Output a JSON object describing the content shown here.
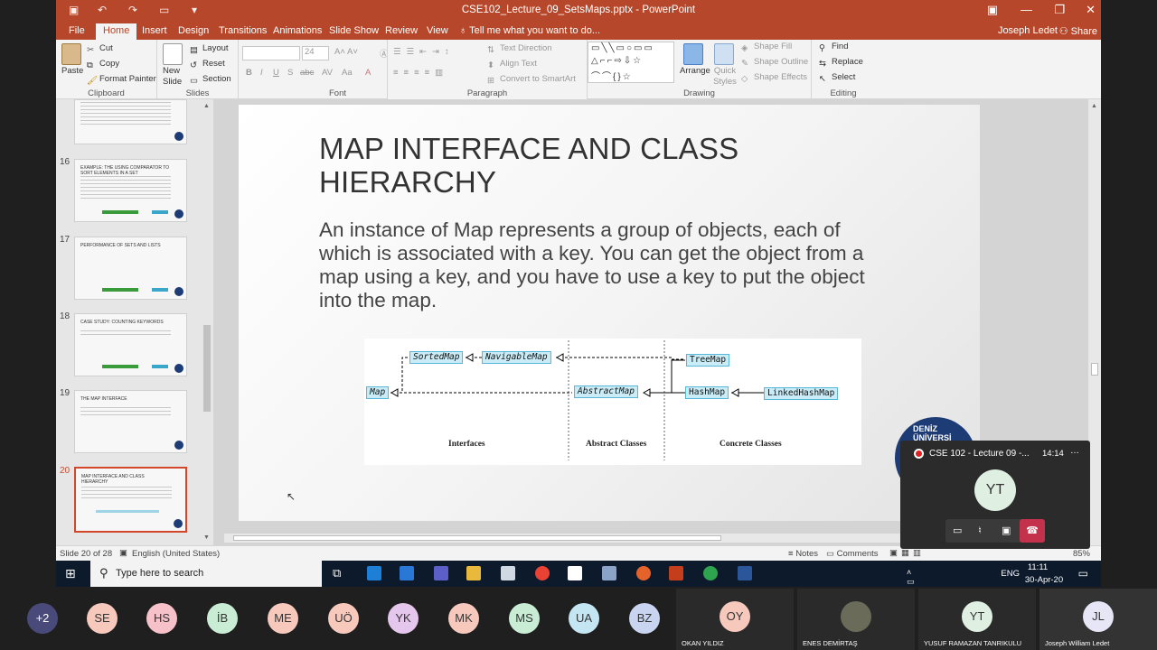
{
  "titlebar": {
    "title": "CSE102_Lecture_09_SetsMaps.pptx - PowerPoint"
  },
  "menu": {
    "tabs": [
      "File",
      "Home",
      "Insert",
      "Design",
      "Transitions",
      "Animations",
      "Slide Show",
      "Review",
      "View"
    ],
    "tell_me": "Tell me what you want to do...",
    "user": "Joseph Ledet",
    "share": "Share"
  },
  "ribbon": {
    "clipboard": {
      "paste": "Paste",
      "cut": "Cut",
      "copy": "Copy",
      "format_painter": "Format Painter",
      "label": "Clipboard"
    },
    "slides": {
      "new_slide": "New Slide",
      "layout": "Layout",
      "reset": "Reset",
      "section": "Section",
      "label": "Slides"
    },
    "font": {
      "size": "24",
      "label": "Font"
    },
    "paragraph": {
      "text_direction": "Text Direction",
      "align_text": "Align Text",
      "convert_smartart": "Convert to SmartArt",
      "label": "Paragraph"
    },
    "drawing": {
      "arrange": "Arrange",
      "quick_styles": "Quick Styles",
      "shape_fill": "Shape Fill",
      "shape_outline": "Shape Outline",
      "shape_effects": "Shape Effects",
      "label": "Drawing"
    },
    "editing": {
      "find": "Find",
      "replace": "Replace",
      "select": "Select",
      "label": "Editing"
    }
  },
  "thumbnails": [
    {
      "num": "16",
      "title": "EXAMPLE: THE USING COMPARATOR TO SORT ELEMENTS IN A SET"
    },
    {
      "num": "17",
      "title": "PERFORMANCE OF SETS AND LISTS"
    },
    {
      "num": "18",
      "title": "CASE STUDY: COUNTING KEYWORDS"
    },
    {
      "num": "19",
      "title": "THE MAP INTERFACE"
    },
    {
      "num": "20",
      "title": "MAP INTERFACE AND CLASS HIERARCHY"
    }
  ],
  "slide": {
    "title": "MAP INTERFACE AND CLASS HIERARCHY",
    "body": "An instance of Map represents a group of objects, each of which is associated with a key. You can get the object from a map using a key, and you have to use a key to put the object into the map.",
    "diagram": {
      "boxes": {
        "sortedmap": "SortedMap",
        "navigablemap": "NavigableMap",
        "treemap": "TreeMap",
        "map": "Map",
        "abstractmap": "AbstractMap",
        "hashmap": "HashMap",
        "linkedhashmap": "LinkedHashMap"
      },
      "columns": {
        "interfaces": "Interfaces",
        "abstract": "Abstract Classes",
        "concrete": "Concrete Classes"
      }
    },
    "logo_text": "DENİZ ÜNİVERSİ",
    "footer": "20"
  },
  "status": {
    "slide_info": "Slide 20 of 28",
    "language": "English (United States)",
    "notes": "Notes",
    "comments": "Comments",
    "zoom": "85%"
  },
  "taskbar": {
    "search": "Type here to search",
    "time": "11:11",
    "date": "30-Apr-20",
    "lang": "ENG"
  },
  "meeting": {
    "popup": {
      "title": "CSE 102 - Lecture 09 -...",
      "elapsed": "14:14",
      "avatar": "YT"
    },
    "participants": [
      "+2",
      "SE",
      "HS",
      "İB",
      "ME",
      "UÖ",
      "YK",
      "MK",
      "MS",
      "UA",
      "BZ"
    ],
    "tiles": [
      {
        "initials": "OY",
        "name": "OKAN YILDIZ"
      },
      {
        "initials": "",
        "name": "ENES DEMİRTAŞ"
      },
      {
        "initials": "YT",
        "name": "YUSUF RAMAZAN TANRIKULU"
      },
      {
        "initials": "JL",
        "name": "Joseph William Ledet"
      }
    ]
  }
}
